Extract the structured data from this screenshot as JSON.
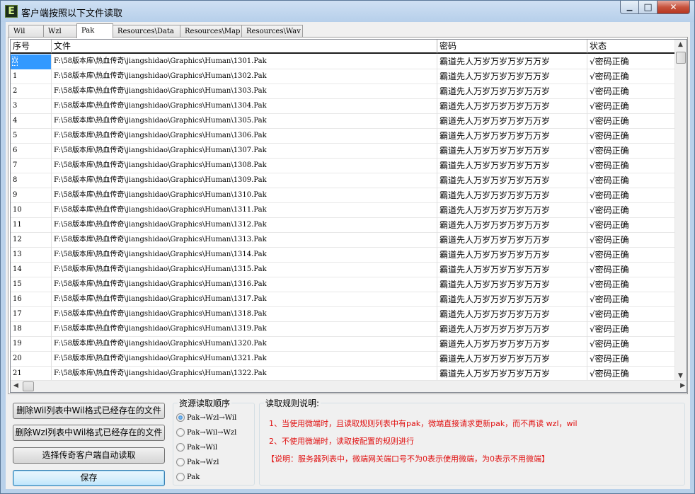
{
  "window": {
    "title": "客户端按照以下文件读取",
    "icon_letter": "E",
    "min_glyph": "▁",
    "max_glyph": "□",
    "close_glyph": "✕"
  },
  "tabs": [
    {
      "label": "Wil",
      "active": false
    },
    {
      "label": "Wzl",
      "active": false
    },
    {
      "label": "Pak",
      "active": true
    },
    {
      "label": "Resources\\Data",
      "active": false
    },
    {
      "label": "Resources\\Map",
      "active": false
    },
    {
      "label": "Resources\\Wav",
      "active": false
    }
  ],
  "table": {
    "columns": [
      "序号",
      "文件",
      "密码",
      "状态"
    ],
    "password": "霸道先人万岁万岁万岁万万岁",
    "status": "√密码正确",
    "rows": [
      {
        "index": "0",
        "file": "F:\\58版本库\\热血传奇\\jiangshidao\\Graphics\\Human\\1301.Pak"
      },
      {
        "index": "1",
        "file": "F:\\58版本库\\热血传奇\\jiangshidao\\Graphics\\Human\\1302.Pak"
      },
      {
        "index": "2",
        "file": "F:\\58版本库\\热血传奇\\jiangshidao\\Graphics\\Human\\1303.Pak"
      },
      {
        "index": "3",
        "file": "F:\\58版本库\\热血传奇\\jiangshidao\\Graphics\\Human\\1304.Pak"
      },
      {
        "index": "4",
        "file": "F:\\58版本库\\热血传奇\\jiangshidao\\Graphics\\Human\\1305.Pak"
      },
      {
        "index": "5",
        "file": "F:\\58版本库\\热血传奇\\jiangshidao\\Graphics\\Human\\1306.Pak"
      },
      {
        "index": "6",
        "file": "F:\\58版本库\\热血传奇\\jiangshidao\\Graphics\\Human\\1307.Pak"
      },
      {
        "index": "7",
        "file": "F:\\58版本库\\热血传奇\\jiangshidao\\Graphics\\Human\\1308.Pak"
      },
      {
        "index": "8",
        "file": "F:\\58版本库\\热血传奇\\jiangshidao\\Graphics\\Human\\1309.Pak"
      },
      {
        "index": "9",
        "file": "F:\\58版本库\\热血传奇\\jiangshidao\\Graphics\\Human\\1310.Pak"
      },
      {
        "index": "10",
        "file": "F:\\58版本库\\热血传奇\\jiangshidao\\Graphics\\Human\\1311.Pak"
      },
      {
        "index": "11",
        "file": "F:\\58版本库\\热血传奇\\jiangshidao\\Graphics\\Human\\1312.Pak"
      },
      {
        "index": "12",
        "file": "F:\\58版本库\\热血传奇\\jiangshidao\\Graphics\\Human\\1313.Pak"
      },
      {
        "index": "13",
        "file": "F:\\58版本库\\热血传奇\\jiangshidao\\Graphics\\Human\\1314.Pak"
      },
      {
        "index": "14",
        "file": "F:\\58版本库\\热血传奇\\jiangshidao\\Graphics\\Human\\1315.Pak"
      },
      {
        "index": "15",
        "file": "F:\\58版本库\\热血传奇\\jiangshidao\\Graphics\\Human\\1316.Pak"
      },
      {
        "index": "16",
        "file": "F:\\58版本库\\热血传奇\\jiangshidao\\Graphics\\Human\\1317.Pak"
      },
      {
        "index": "17",
        "file": "F:\\58版本库\\热血传奇\\jiangshidao\\Graphics\\Human\\1318.Pak"
      },
      {
        "index": "18",
        "file": "F:\\58版本库\\热血传奇\\jiangshidao\\Graphics\\Human\\1319.Pak"
      },
      {
        "index": "19",
        "file": "F:\\58版本库\\热血传奇\\jiangshidao\\Graphics\\Human\\1320.Pak"
      },
      {
        "index": "20",
        "file": "F:\\58版本库\\热血传奇\\jiangshidao\\Graphics\\Human\\1321.Pak"
      },
      {
        "index": "21",
        "file": "F:\\58版本库\\热血传奇\\jiangshidao\\Graphics\\Human\\1322.Pak"
      }
    ]
  },
  "buttons": {
    "delete_wil": "删除Wil列表中Wil格式已经存在的文件",
    "delete_wzl": "删除Wzl列表中Wil格式已经存在的文件",
    "select_client": "选择传奇客户端自动读取",
    "save": "保存"
  },
  "order_group": {
    "title": "资源读取顺序",
    "options": [
      {
        "label": "Pak→Wzl→Wil",
        "checked": true
      },
      {
        "label": "Pak→Wil→Wzl",
        "checked": false
      },
      {
        "label": "Pak→Wil",
        "checked": false
      },
      {
        "label": "Pak→Wzl",
        "checked": false
      },
      {
        "label": "Pak",
        "checked": false
      }
    ]
  },
  "rules_group": {
    "title": "读取规则说明:",
    "line1": "1、当使用微端时，且读取规则列表中有pak，微端直接请求更新pak，而不再读 wzl，wil",
    "line2": "2、不使用微端时，读取按配置的规则进行",
    "line3": "【说明：服务器列表中，微端网关端口号不为0表示使用微端，为0表示不用微端】",
    "text_color": "#e01010"
  }
}
